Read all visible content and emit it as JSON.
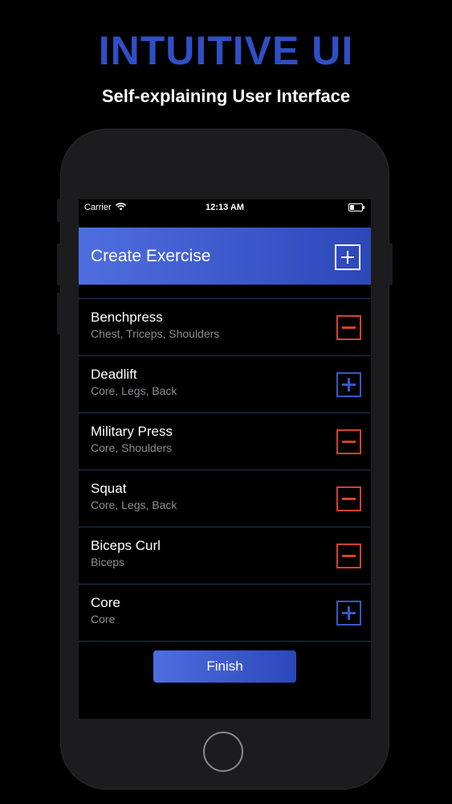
{
  "promo": {
    "title": "INTUITIVE UI",
    "subtitle": "Self-explaining User Interface"
  },
  "status_bar": {
    "carrier": "Carrier",
    "time": "12:13 AM"
  },
  "header": {
    "title": "Create Exercise",
    "add_icon": "plus-square-icon"
  },
  "exercises": [
    {
      "name": "Benchpress",
      "muscles": "Chest, Triceps, Shoulders",
      "action": "remove"
    },
    {
      "name": "Deadlift",
      "muscles": "Core, Legs, Back",
      "action": "add"
    },
    {
      "name": "Military Press",
      "muscles": "Core, Shoulders",
      "action": "remove"
    },
    {
      "name": "Squat",
      "muscles": "Core, Legs, Back",
      "action": "remove"
    },
    {
      "name": "Biceps Curl",
      "muscles": "Biceps",
      "action": "remove"
    },
    {
      "name": "Core",
      "muscles": "Core",
      "action": "add"
    }
  ],
  "finish_label": "Finish",
  "colors": {
    "accent_blue": "#3a57c8",
    "promo_blue": "#2f4fc4",
    "remove_red": "#d8402b",
    "background": "#000000"
  }
}
